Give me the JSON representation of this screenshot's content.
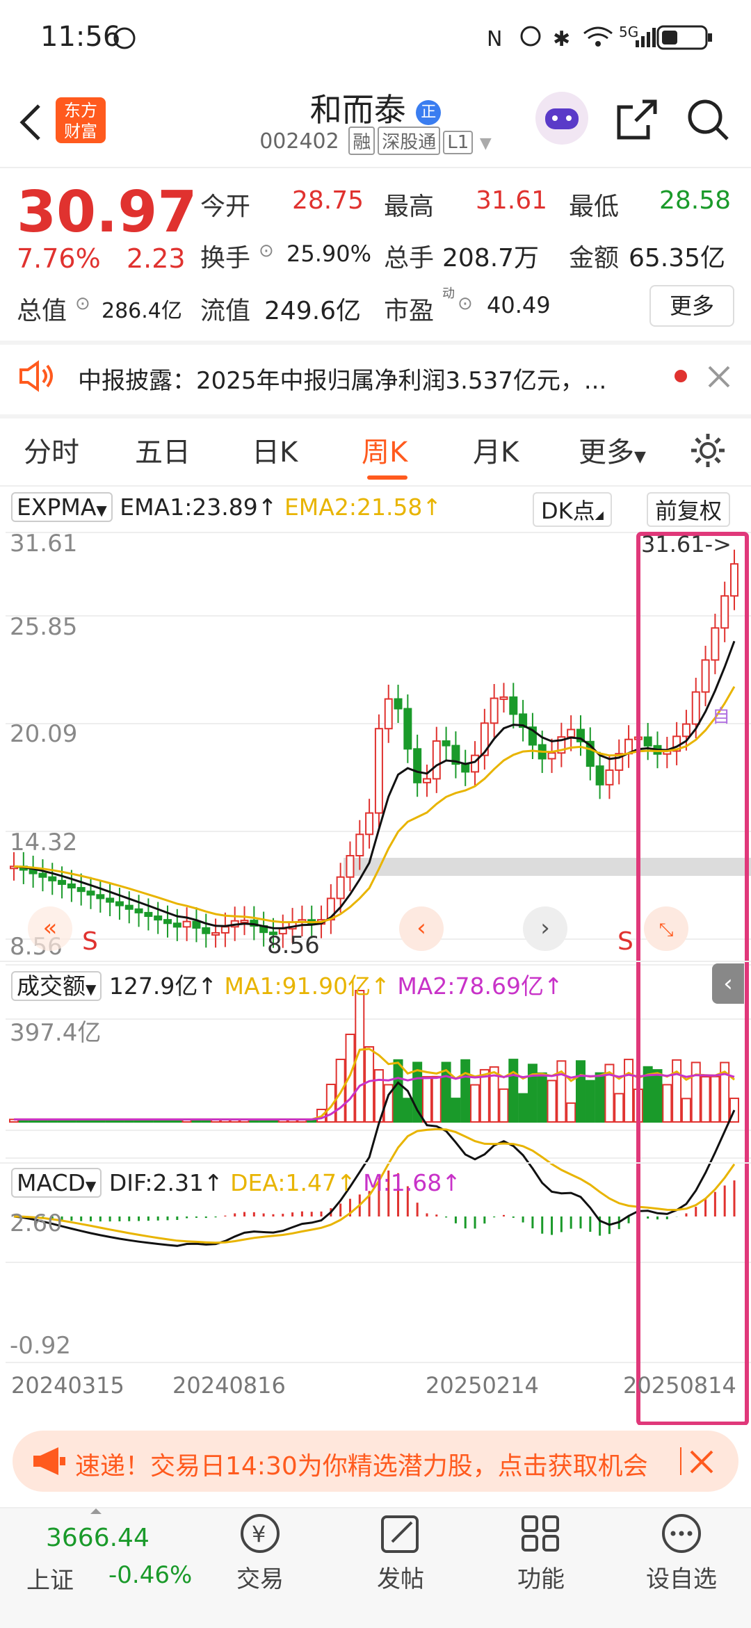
{
  "status_bar": {
    "time": "11:56",
    "network": "5G"
  },
  "header": {
    "back_icon": "back-arrow",
    "logo_line1": "东方",
    "logo_line2": "财富",
    "stock_name": "和而泰",
    "badge": "正",
    "stock_code": "002402",
    "tags": [
      "融",
      "深股通",
      "L1"
    ]
  },
  "quote": {
    "price": "30.97",
    "change_pct": "7.76%",
    "change_amt": "2.23",
    "open_label": "今开",
    "open": "28.75",
    "high_label": "最高",
    "high": "31.61",
    "low_label": "最低",
    "low": "28.58",
    "turnover_label": "换手",
    "turnover": "25.90%",
    "volume_label": "总手",
    "volume": "208.7万",
    "amount_label": "金额",
    "amount": "65.35亿",
    "mktcap_label": "总值",
    "mktcap": "286.4亿",
    "float_label": "流值",
    "float": "249.6亿",
    "pe_label": "市盈",
    "pe_sup": "动",
    "pe": "40.49",
    "more_label": "更多"
  },
  "notice": {
    "text": "中报披露：2025年中报归属净利润3.537亿元，..."
  },
  "tabs": [
    {
      "label": "分时"
    },
    {
      "label": "五日"
    },
    {
      "label": "日K"
    },
    {
      "label": "周K",
      "active": true
    },
    {
      "label": "月K"
    },
    {
      "label": "更多"
    }
  ],
  "indicators": {
    "main": {
      "name": "EXPMA",
      "ema1": "EMA1:23.89↑",
      "ema2": "EMA2:21.58↑",
      "dk_label": "DK点",
      "adjust_label": "前复权"
    },
    "volume": {
      "name": "成交额",
      "value": "127.9亿↑",
      "ma1": "MA1:91.90亿↑",
      "ma2": "MA2:78.69亿↑"
    },
    "macd": {
      "name": "MACD",
      "dif": "DIF:2.31↑",
      "dea": "DEA:1.47↑",
      "m": "M:1.68↑"
    }
  },
  "chart_labels": {
    "price_axis": [
      "31.61",
      "25.85",
      "20.09",
      "14.32",
      "8.56"
    ],
    "high_marker": "31.61->",
    "low_marker": "8.56",
    "signal_s": "S",
    "self_mark": "自",
    "volume_axis": "397.4亿",
    "macd_top": "2.60",
    "macd_bottom": "-0.92",
    "dates": [
      "20240315",
      "20240816",
      "20250214",
      "20250814"
    ]
  },
  "colors": {
    "up": "#e0322f",
    "down": "#1a9a2a",
    "accent": "#ff5a1e",
    "highlight_box": "#e0387a",
    "ma1": "#e8b400",
    "ma2": "#c832c8"
  },
  "ad": {
    "text": "速递！交易日14:30为你精选潜力股，点击获取机会"
  },
  "bottom_nav": {
    "index_value": "3666.44",
    "index_name": "上证",
    "index_change": "-0.46%",
    "items": [
      {
        "label": "交易"
      },
      {
        "label": "发帖"
      },
      {
        "label": "功能"
      },
      {
        "label": "设自选"
      }
    ]
  }
}
